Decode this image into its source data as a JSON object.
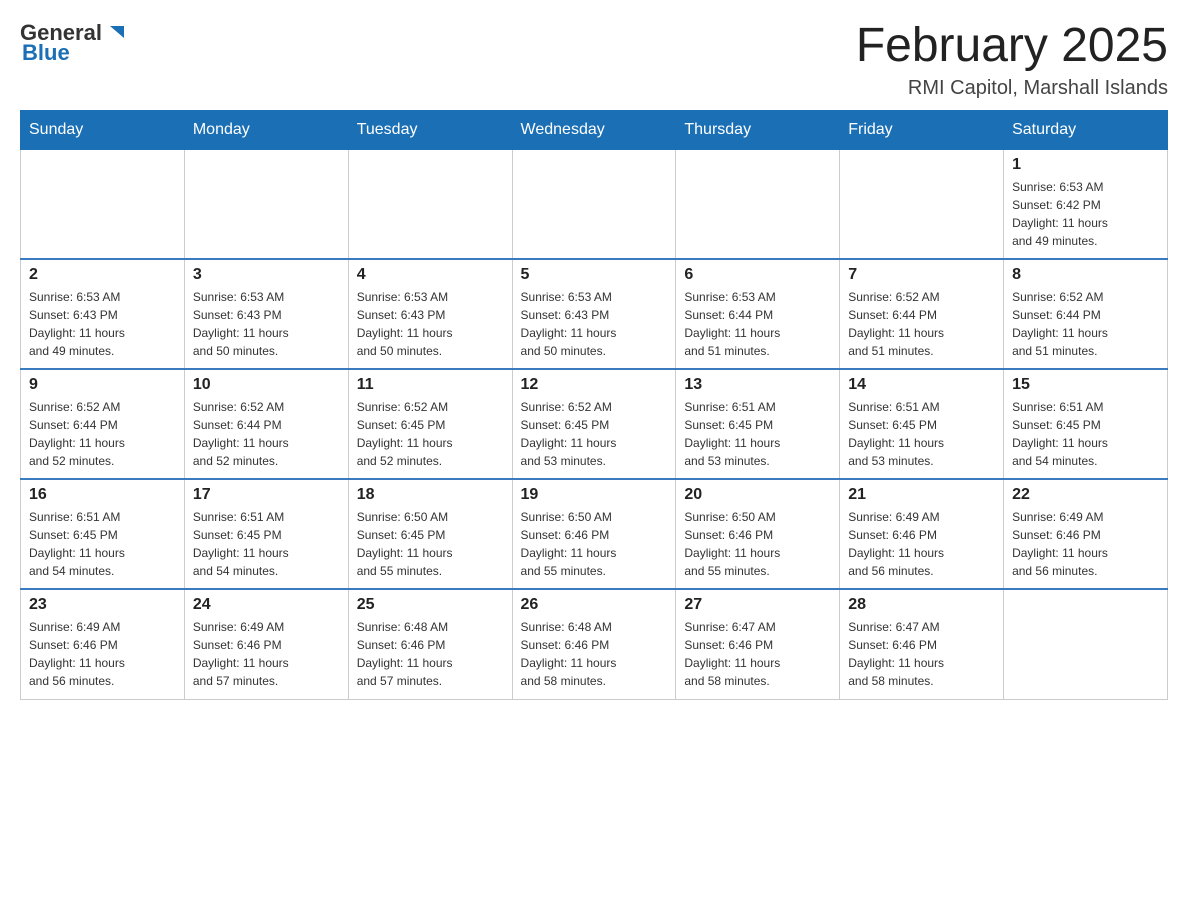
{
  "header": {
    "logo": {
      "general": "General",
      "blue": "Blue"
    },
    "title": "February 2025",
    "subtitle": "RMI Capitol, Marshall Islands"
  },
  "calendar": {
    "days": [
      "Sunday",
      "Monday",
      "Tuesday",
      "Wednesday",
      "Thursday",
      "Friday",
      "Saturday"
    ],
    "weeks": [
      {
        "cells": [
          {
            "day": "",
            "info": ""
          },
          {
            "day": "",
            "info": ""
          },
          {
            "day": "",
            "info": ""
          },
          {
            "day": "",
            "info": ""
          },
          {
            "day": "",
            "info": ""
          },
          {
            "day": "",
            "info": ""
          },
          {
            "day": "1",
            "info": "Sunrise: 6:53 AM\nSunset: 6:42 PM\nDaylight: 11 hours\nand 49 minutes."
          }
        ]
      },
      {
        "cells": [
          {
            "day": "2",
            "info": "Sunrise: 6:53 AM\nSunset: 6:43 PM\nDaylight: 11 hours\nand 49 minutes."
          },
          {
            "day": "3",
            "info": "Sunrise: 6:53 AM\nSunset: 6:43 PM\nDaylight: 11 hours\nand 50 minutes."
          },
          {
            "day": "4",
            "info": "Sunrise: 6:53 AM\nSunset: 6:43 PM\nDaylight: 11 hours\nand 50 minutes."
          },
          {
            "day": "5",
            "info": "Sunrise: 6:53 AM\nSunset: 6:43 PM\nDaylight: 11 hours\nand 50 minutes."
          },
          {
            "day": "6",
            "info": "Sunrise: 6:53 AM\nSunset: 6:44 PM\nDaylight: 11 hours\nand 51 minutes."
          },
          {
            "day": "7",
            "info": "Sunrise: 6:52 AM\nSunset: 6:44 PM\nDaylight: 11 hours\nand 51 minutes."
          },
          {
            "day": "8",
            "info": "Sunrise: 6:52 AM\nSunset: 6:44 PM\nDaylight: 11 hours\nand 51 minutes."
          }
        ]
      },
      {
        "cells": [
          {
            "day": "9",
            "info": "Sunrise: 6:52 AM\nSunset: 6:44 PM\nDaylight: 11 hours\nand 52 minutes."
          },
          {
            "day": "10",
            "info": "Sunrise: 6:52 AM\nSunset: 6:44 PM\nDaylight: 11 hours\nand 52 minutes."
          },
          {
            "day": "11",
            "info": "Sunrise: 6:52 AM\nSunset: 6:45 PM\nDaylight: 11 hours\nand 52 minutes."
          },
          {
            "day": "12",
            "info": "Sunrise: 6:52 AM\nSunset: 6:45 PM\nDaylight: 11 hours\nand 53 minutes."
          },
          {
            "day": "13",
            "info": "Sunrise: 6:51 AM\nSunset: 6:45 PM\nDaylight: 11 hours\nand 53 minutes."
          },
          {
            "day": "14",
            "info": "Sunrise: 6:51 AM\nSunset: 6:45 PM\nDaylight: 11 hours\nand 53 minutes."
          },
          {
            "day": "15",
            "info": "Sunrise: 6:51 AM\nSunset: 6:45 PM\nDaylight: 11 hours\nand 54 minutes."
          }
        ]
      },
      {
        "cells": [
          {
            "day": "16",
            "info": "Sunrise: 6:51 AM\nSunset: 6:45 PM\nDaylight: 11 hours\nand 54 minutes."
          },
          {
            "day": "17",
            "info": "Sunrise: 6:51 AM\nSunset: 6:45 PM\nDaylight: 11 hours\nand 54 minutes."
          },
          {
            "day": "18",
            "info": "Sunrise: 6:50 AM\nSunset: 6:45 PM\nDaylight: 11 hours\nand 55 minutes."
          },
          {
            "day": "19",
            "info": "Sunrise: 6:50 AM\nSunset: 6:46 PM\nDaylight: 11 hours\nand 55 minutes."
          },
          {
            "day": "20",
            "info": "Sunrise: 6:50 AM\nSunset: 6:46 PM\nDaylight: 11 hours\nand 55 minutes."
          },
          {
            "day": "21",
            "info": "Sunrise: 6:49 AM\nSunset: 6:46 PM\nDaylight: 11 hours\nand 56 minutes."
          },
          {
            "day": "22",
            "info": "Sunrise: 6:49 AM\nSunset: 6:46 PM\nDaylight: 11 hours\nand 56 minutes."
          }
        ]
      },
      {
        "cells": [
          {
            "day": "23",
            "info": "Sunrise: 6:49 AM\nSunset: 6:46 PM\nDaylight: 11 hours\nand 56 minutes."
          },
          {
            "day": "24",
            "info": "Sunrise: 6:49 AM\nSunset: 6:46 PM\nDaylight: 11 hours\nand 57 minutes."
          },
          {
            "day": "25",
            "info": "Sunrise: 6:48 AM\nSunset: 6:46 PM\nDaylight: 11 hours\nand 57 minutes."
          },
          {
            "day": "26",
            "info": "Sunrise: 6:48 AM\nSunset: 6:46 PM\nDaylight: 11 hours\nand 58 minutes."
          },
          {
            "day": "27",
            "info": "Sunrise: 6:47 AM\nSunset: 6:46 PM\nDaylight: 11 hours\nand 58 minutes."
          },
          {
            "day": "28",
            "info": "Sunrise: 6:47 AM\nSunset: 6:46 PM\nDaylight: 11 hours\nand 58 minutes."
          },
          {
            "day": "",
            "info": ""
          }
        ]
      }
    ]
  }
}
